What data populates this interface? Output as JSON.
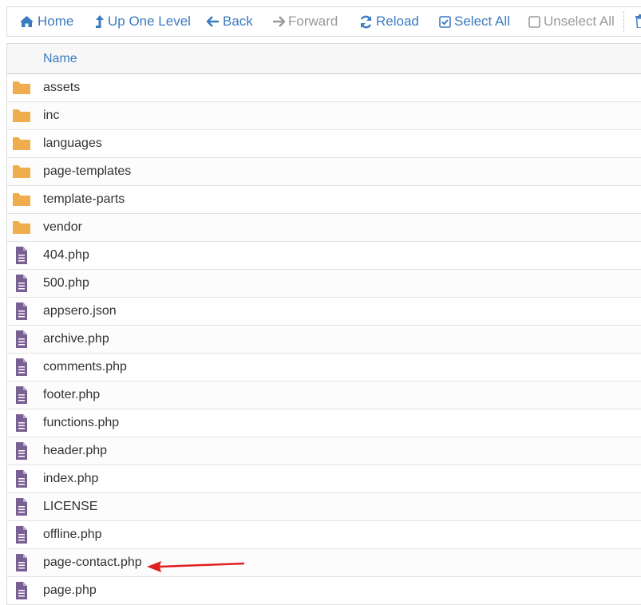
{
  "toolbar": {
    "home_label": "Home",
    "up_label": "Up One Level",
    "back_label": "Back",
    "forward_label": "Forward",
    "reload_label": "Reload",
    "select_all_label": "Select All",
    "unselect_all_label": "Unselect All"
  },
  "table": {
    "column_name": "Name",
    "rows": [
      {
        "name": "assets",
        "type": "folder"
      },
      {
        "name": "inc",
        "type": "folder"
      },
      {
        "name": "languages",
        "type": "folder"
      },
      {
        "name": "page-templates",
        "type": "folder"
      },
      {
        "name": "template-parts",
        "type": "folder"
      },
      {
        "name": "vendor",
        "type": "folder"
      },
      {
        "name": "404.php",
        "type": "file"
      },
      {
        "name": "500.php",
        "type": "file"
      },
      {
        "name": "appsero.json",
        "type": "file"
      },
      {
        "name": "archive.php",
        "type": "file"
      },
      {
        "name": "comments.php",
        "type": "file"
      },
      {
        "name": "footer.php",
        "type": "file"
      },
      {
        "name": "functions.php",
        "type": "file"
      },
      {
        "name": "header.php",
        "type": "file"
      },
      {
        "name": "index.php",
        "type": "file"
      },
      {
        "name": "LICENSE",
        "type": "file"
      },
      {
        "name": "offline.php",
        "type": "file"
      },
      {
        "name": "page-contact.php",
        "type": "file"
      },
      {
        "name": "page.php",
        "type": "file"
      }
    ]
  },
  "colors": {
    "accent": "#3b7bbf",
    "folder": "#f0ad4e",
    "file": "#7a5f93",
    "annotation_arrow": "#e02020"
  }
}
